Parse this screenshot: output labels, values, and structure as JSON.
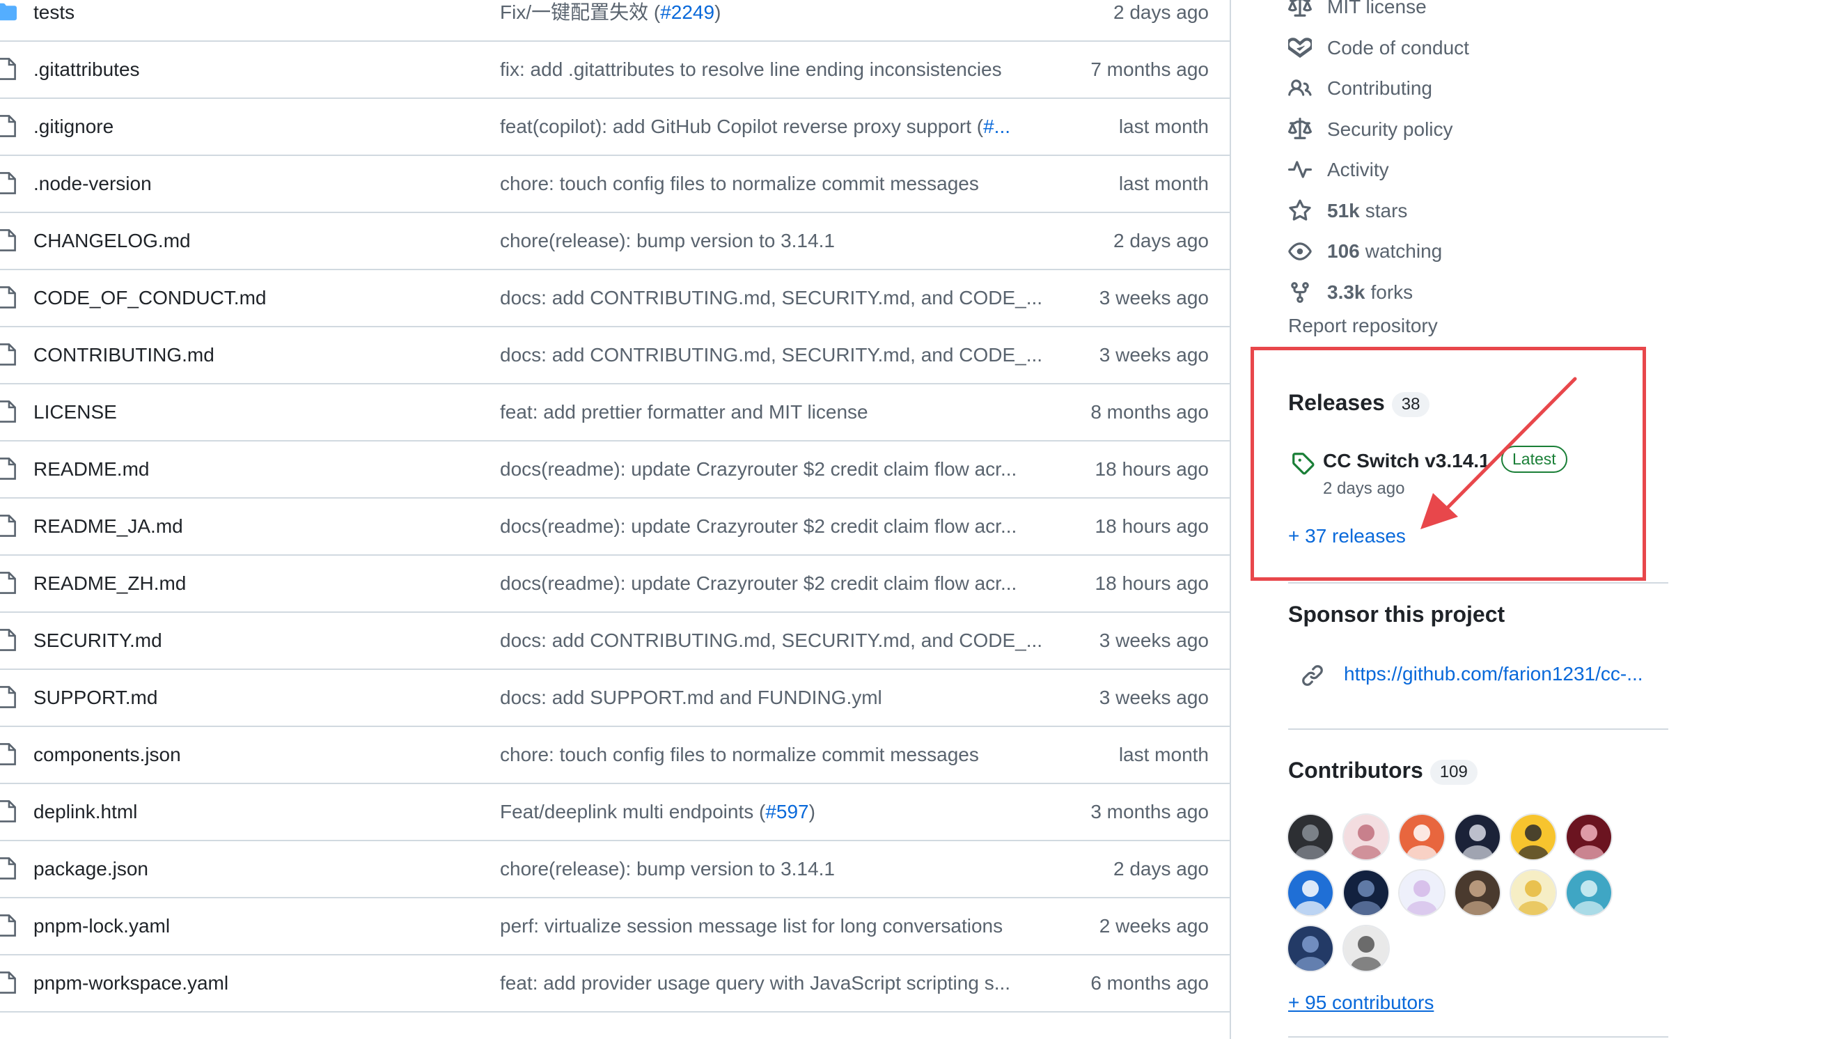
{
  "files": [
    {
      "type": "folder",
      "name": "tests",
      "message": "Fix/一键配置失效 (",
      "link": "#2249",
      "message_tail": ")",
      "date": "2 days ago"
    },
    {
      "type": "file",
      "name": ".gitattributes",
      "message": "fix: add .gitattributes to resolve line ending inconsistencies",
      "date": "7 months ago"
    },
    {
      "type": "file",
      "name": ".gitignore",
      "message": "feat(copilot): add GitHub Copilot reverse proxy support (",
      "link": "#...",
      "date": "last month"
    },
    {
      "type": "file",
      "name": ".node-version",
      "message": "chore: touch config files to normalize commit messages",
      "date": "last month"
    },
    {
      "type": "file",
      "name": "CHANGELOG.md",
      "message": "chore(release): bump version to 3.14.1",
      "date": "2 days ago"
    },
    {
      "type": "file",
      "name": "CODE_OF_CONDUCT.md",
      "message": "docs: add CONTRIBUTING.md, SECURITY.md, and CODE_...",
      "date": "3 weeks ago"
    },
    {
      "type": "file",
      "name": "CONTRIBUTING.md",
      "message": "docs: add CONTRIBUTING.md, SECURITY.md, and CODE_...",
      "date": "3 weeks ago"
    },
    {
      "type": "file",
      "name": "LICENSE",
      "message": "feat: add prettier formatter and MIT license",
      "date": "8 months ago"
    },
    {
      "type": "file",
      "name": "README.md",
      "message": "docs(readme): update Crazyrouter $2 credit claim flow acr...",
      "date": "18 hours ago"
    },
    {
      "type": "file",
      "name": "README_JA.md",
      "message": "docs(readme): update Crazyrouter $2 credit claim flow acr...",
      "date": "18 hours ago"
    },
    {
      "type": "file",
      "name": "README_ZH.md",
      "message": "docs(readme): update Crazyrouter $2 credit claim flow acr...",
      "date": "18 hours ago"
    },
    {
      "type": "file",
      "name": "SECURITY.md",
      "message": "docs: add CONTRIBUTING.md, SECURITY.md, and CODE_...",
      "date": "3 weeks ago"
    },
    {
      "type": "file",
      "name": "SUPPORT.md",
      "message": "docs: add SUPPORT.md and FUNDING.yml",
      "date": "3 weeks ago"
    },
    {
      "type": "file",
      "name": "components.json",
      "message": "chore: touch config files to normalize commit messages",
      "date": "last month"
    },
    {
      "type": "file",
      "name": "deplink.html",
      "message": "Feat/deeplink multi endpoints (",
      "link": "#597",
      "message_tail": ")",
      "date": "3 months ago"
    },
    {
      "type": "file",
      "name": "package.json",
      "message": "chore(release): bump version to 3.14.1",
      "date": "2 days ago"
    },
    {
      "type": "file",
      "name": "pnpm-lock.yaml",
      "message": "perf: virtualize session message list for long conversations",
      "date": "2 weeks ago"
    },
    {
      "type": "file",
      "name": "pnpm-workspace.yaml",
      "message": "feat: add provider usage query with JavaScript scripting s...",
      "date": "6 months ago"
    }
  ],
  "sidebar": {
    "links": [
      {
        "icon": "law-icon",
        "label": "MIT license"
      },
      {
        "icon": "code-of-conduct-icon",
        "label": "Code of conduct"
      },
      {
        "icon": "people-icon",
        "label": "Contributing"
      },
      {
        "icon": "law-icon",
        "label": "Security policy"
      },
      {
        "icon": "pulse-icon",
        "label": "Activity"
      },
      {
        "icon": "star-icon",
        "count": "51k",
        "label": "stars"
      },
      {
        "icon": "eye-icon",
        "count": "106",
        "label": "watching"
      },
      {
        "icon": "fork-icon",
        "count": "3.3k",
        "label": "forks"
      }
    ],
    "report": "Report repository",
    "releases": {
      "title": "Releases",
      "count": "38",
      "latest_name": "CC Switch v3.14.1",
      "latest_badge": "Latest",
      "latest_date": "2 days ago",
      "more_link": "+ 37 releases"
    },
    "sponsor": {
      "title": "Sponsor this project",
      "url": "https://github.com/farion1231/cc-..."
    },
    "contributors": {
      "title": "Contributors",
      "count": "109",
      "more_link": "+ 95 contributors",
      "avatars": [
        {
          "bg": "#2d2f33",
          "fg": "#8a8f98"
        },
        {
          "bg": "#f3dde0",
          "fg": "#c0707c"
        },
        {
          "bg": "#e8663e",
          "fg": "#ffffff"
        },
        {
          "bg": "#1b2238",
          "fg": "#d8dbe6"
        },
        {
          "bg": "#f7c42e",
          "fg": "#2b2b2b"
        },
        {
          "bg": "#6b1420",
          "fg": "#f2b3c0"
        },
        {
          "bg": "#1f6fd6",
          "fg": "#ffffff"
        },
        {
          "bg": "#12213f",
          "fg": "#6f89b8"
        },
        {
          "bg": "#eef0fb",
          "fg": "#d3b9e8"
        },
        {
          "bg": "#4a3a2e",
          "fg": "#caa98a"
        },
        {
          "bg": "#f6eec5",
          "fg": "#e6b93a"
        },
        {
          "bg": "#3fa6c4",
          "fg": "#d9f2f7"
        },
        {
          "bg": "#233a66",
          "fg": "#7f9ccf"
        },
        {
          "bg": "#e9e9e9",
          "fg": "#555555"
        }
      ]
    }
  },
  "colors": {
    "accent": "#0969da",
    "muted": "#59636e",
    "border": "#d1d9e0",
    "latest": "#1a7f37",
    "annotation": "#e8474b"
  }
}
